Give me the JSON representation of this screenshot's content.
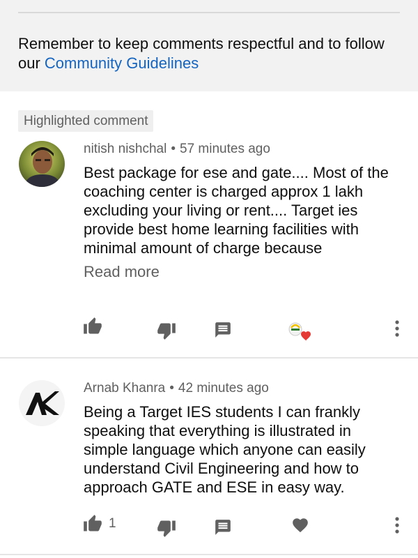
{
  "notice": {
    "text": "Remember to keep comments respectful and to follow our ",
    "link_label": "Community Guidelines"
  },
  "comments": [
    {
      "badge": "Highlighted comment",
      "author": "nitish nishchal",
      "separator": "•",
      "time": "57 minutes ago",
      "text": "Best package for ese and gate.... Most of the coaching center is charged approx 1 lakh excluding your living or rent.... Target ies provide best home learning facilities with minimal amount of charge because",
      "read_more": "Read more",
      "avatar_icon": "user-photo-avatar",
      "actions": [
        "thumbs-up-icon",
        "thumbs-down-icon",
        "reply-icon",
        "creator-heart-icon",
        "more-vert-icon"
      ]
    },
    {
      "author": "Arnab Khanra",
      "separator": "•",
      "time": "42 minutes ago",
      "text": "Being a Target IES students I can frankly speaking that everything is illustrated in simple language which anyone can easily understand Civil Engineering and how to approach GATE and ESE in easy way.",
      "like_count": "1",
      "avatar_icon": "ak-logo-avatar",
      "actions": [
        "thumbs-up-icon",
        "thumbs-down-icon",
        "reply-icon",
        "heart-icon",
        "more-vert-icon"
      ]
    }
  ],
  "colors": {
    "link": "#1565c0",
    "secondary_text": "#606060",
    "icon": "#606060",
    "heart": "#e53935"
  }
}
